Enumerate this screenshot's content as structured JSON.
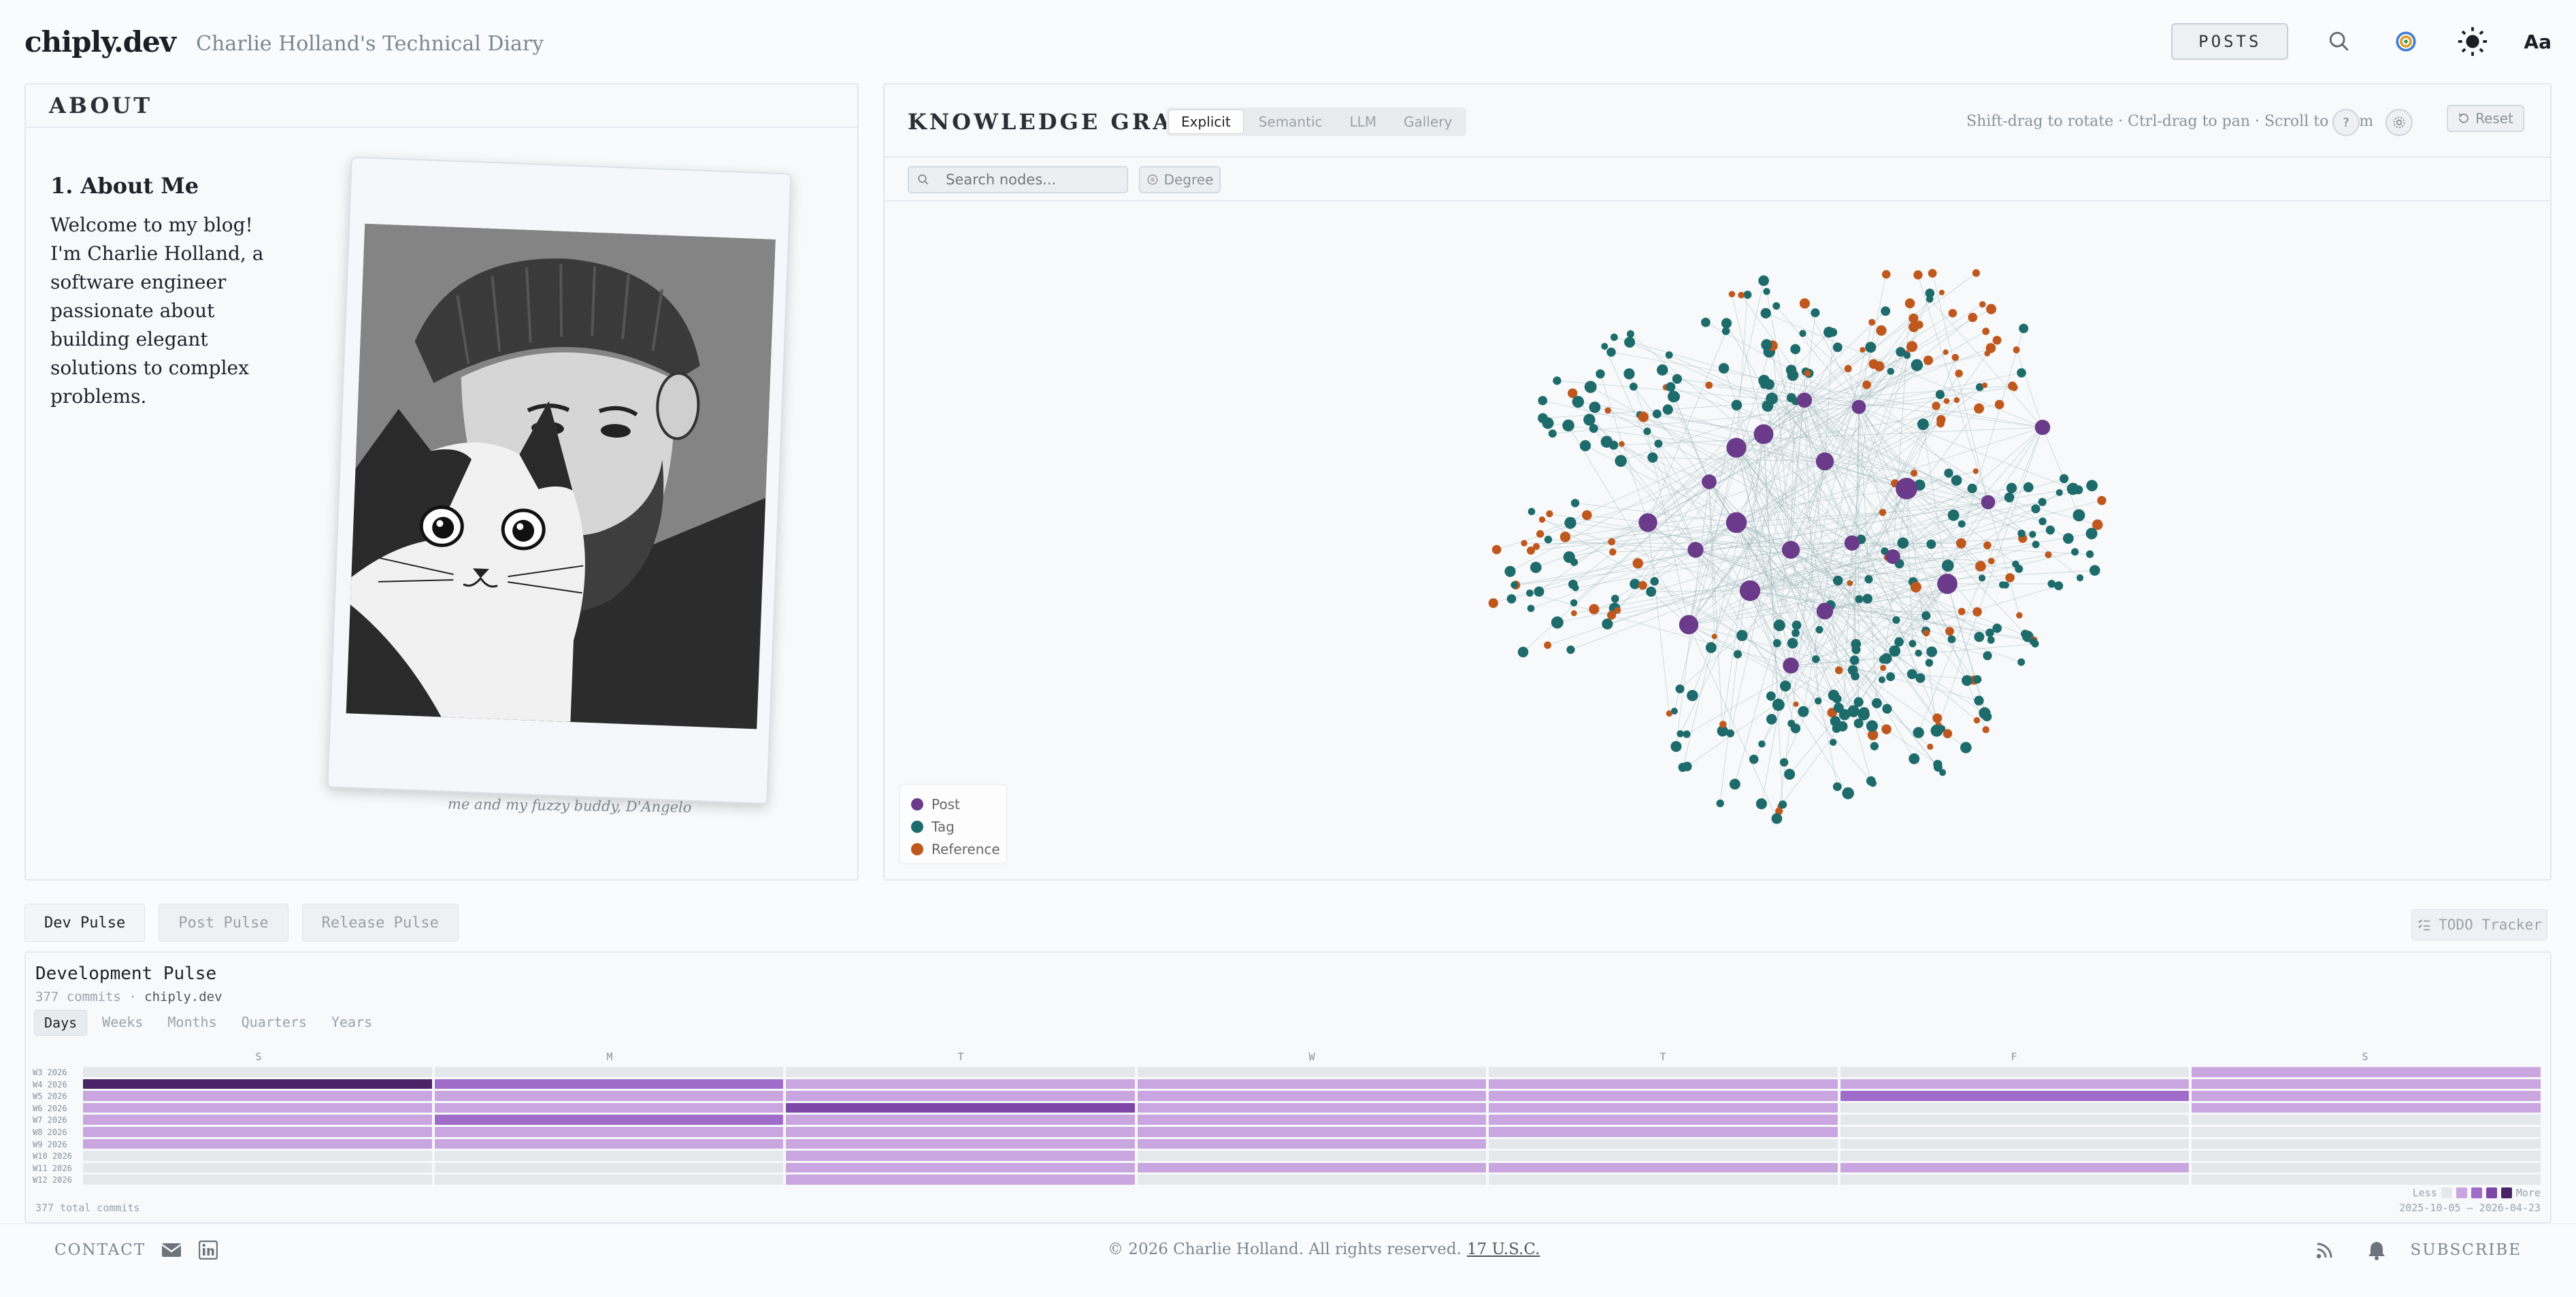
{
  "header": {
    "brand": "chiply.dev",
    "tagline": "Charlie Holland's Technical Diary",
    "posts_label": "POSTS",
    "font_toggle_label": "Aa"
  },
  "about": {
    "title": "ABOUT",
    "heading": "1. About Me",
    "text": "Welcome to my blog! I'm Charlie Holland, a software engineer passionate about building elegant solutions to complex problems.",
    "caption": "me and my fuzzy buddy, D'Angelo"
  },
  "knowledge_graph": {
    "title": "KNOWLEDGE GRAPH",
    "tabs": [
      "Explicit",
      "Semantic",
      "LLM",
      "Gallery"
    ],
    "active_tab": "Explicit",
    "hint": "Shift-drag to rotate · Ctrl-drag to pan · Scroll to zoom",
    "help_label": "?",
    "reset_label": "Reset",
    "search_placeholder": "Search nodes...",
    "degree_label": "Degree",
    "legend": [
      {
        "label": "Post",
        "color": "#6b3a8a"
      },
      {
        "label": "Tag",
        "color": "#1e6b6b"
      },
      {
        "label": "Reference",
        "color": "#c0581e"
      }
    ]
  },
  "pulse": {
    "tabs": [
      "Dev Pulse",
      "Post Pulse",
      "Release Pulse"
    ],
    "active_tab": "Dev Pulse",
    "todo_label": "TODO Tracker",
    "title": "Development Pulse",
    "commits": "377 commits",
    "repo": "chiply.dev",
    "ranges": [
      "Days",
      "Weeks",
      "Months",
      "Quarters",
      "Years"
    ],
    "active_range": "Days",
    "days": [
      "S",
      "M",
      "T",
      "W",
      "T",
      "F",
      "S"
    ],
    "weeks": [
      "W3 2026",
      "W4 2026",
      "W5 2026",
      "W6 2026",
      "W7 2026",
      "W8 2026",
      "W9 2026",
      "W10 2026",
      "W11 2026",
      "W12 2026"
    ],
    "levels": [
      [
        0,
        0,
        0,
        0,
        0,
        0,
        1
      ],
      [
        4,
        2,
        1,
        1,
        1,
        1,
        1
      ],
      [
        1,
        1,
        1,
        1,
        1,
        2,
        1
      ],
      [
        1,
        1,
        3,
        1,
        1,
        0,
        1
      ],
      [
        1,
        2,
        1,
        1,
        1,
        0,
        0
      ],
      [
        1,
        1,
        1,
        1,
        1,
        0,
        0
      ],
      [
        1,
        1,
        1,
        1,
        0,
        0,
        0
      ],
      [
        0,
        0,
        1,
        0,
        0,
        0,
        0
      ],
      [
        0,
        0,
        1,
        1,
        1,
        1,
        0
      ],
      [
        0,
        0,
        1,
        0,
        0,
        0,
        0
      ]
    ],
    "level_colors": [
      "#e5e8eb",
      "#c9a6e0",
      "#a06cc9",
      "#7d47a8",
      "#4a2466"
    ],
    "total": "377 total commits",
    "legend_less": "Less",
    "legend_more": "More",
    "date_range": "2025-10-05 – 2026-04-23"
  },
  "footer": {
    "contact_label": "CONTACT",
    "copyright": "© 2026 Charlie Holland. All rights reserved.",
    "usc_label": "17 U.S.C.",
    "subscribe_label": "SUBSCRIBE"
  }
}
